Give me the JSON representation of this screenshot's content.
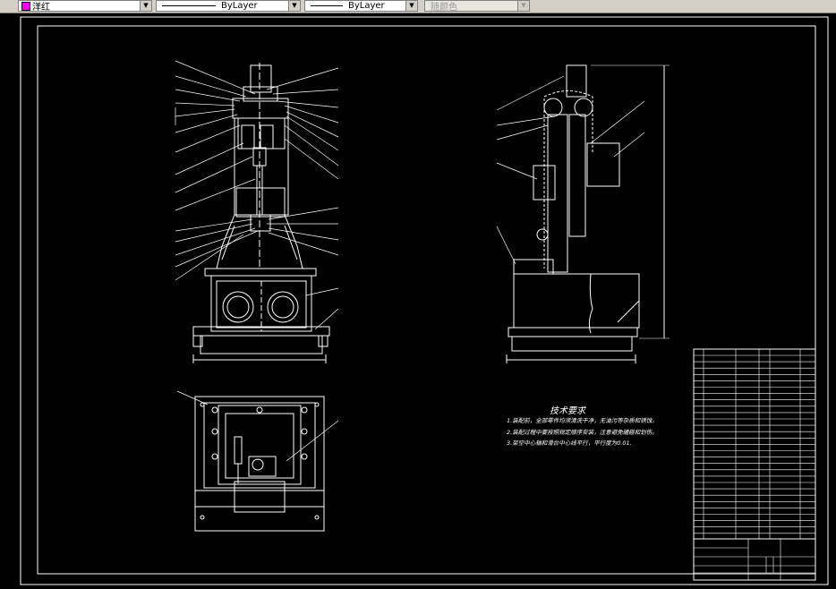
{
  "toolbar": {
    "color_label": "洋红",
    "color_swatch": "#ff00ff",
    "linetype_label": "ByLayer",
    "lineweight_label": "ByLayer",
    "plotstyle_label": "随颜色"
  },
  "drawing": {
    "tech_req_title": "技术要求",
    "tech_req_lines": [
      "1.装配前，全部零件均须清洗干净，无油污等杂质和锈蚀。",
      "2.装配过程中要按照规定顺序安装，注意避免磕碰和划伤。",
      "3.架空中心轴和滑台中心线平行，平行度为0.01."
    ],
    "colors": {
      "background": "#000000",
      "lines": "#ffffff",
      "toolbar": "#d4d0c8"
    }
  }
}
